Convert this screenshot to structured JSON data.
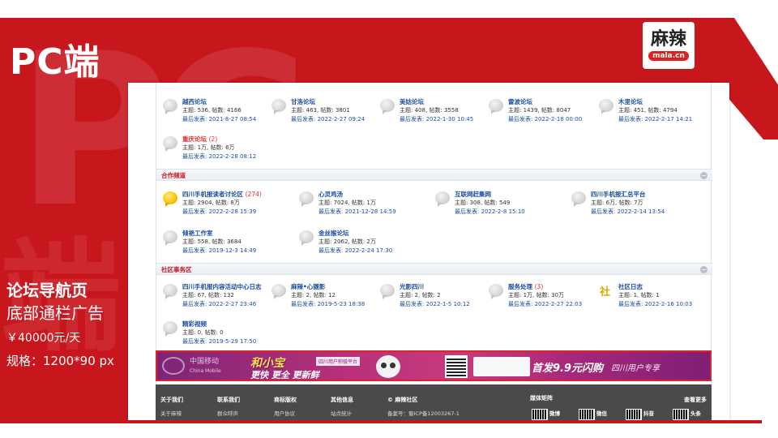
{
  "slide": {
    "title": "PC端",
    "side_lines": [
      "论坛导航页",
      "底部通栏广告",
      "￥40000元/天",
      "规格：1200*90 px"
    ],
    "watermark": "PC",
    "watermark2": "端"
  },
  "logo": {
    "cn": "麻辣",
    "en": "mala.cn"
  },
  "forum": {
    "rows": [
      {
        "items": [
          {
            "name": "越西论坛",
            "stat": "主题: 536, 帖数: 4166",
            "last": "最后发表: 2021-8-27 08:54"
          },
          {
            "name": "甘洛论坛",
            "stat": "主题: 463, 帖数: 3801",
            "last": "最后发表: 2022-2-27 09:24"
          },
          {
            "name": "美姑论坛",
            "stat": "主题: 408, 帖数: 3558",
            "last": "最后发表: 2022-1-30 10:45"
          },
          {
            "name": "雷波论坛",
            "stat": "主题: 1439, 帖数: 8047",
            "last": "最后发表: 2022-2-18 00:00"
          },
          {
            "name": "木里论坛",
            "stat": "主题: 451, 帖数: 4794",
            "last": "最后发表: 2022-2-17 14:21"
          }
        ]
      },
      {
        "items": [
          {
            "name": "重庆论坛",
            "count": "(2)",
            "stat": "主题: 1万, 帖数: 6万",
            "last": "最后发表: 2022-2-28 08:12"
          }
        ]
      }
    ],
    "sections": [
      {
        "title": "合作频道",
        "toggle": "−",
        "rows": [
          {
            "items": [
              {
                "name": "四川手机报读者讨论区",
                "count": "(274)",
                "stat": "主题: 2904, 帖数: 8万",
                "last": "最后发表: 2022-2-28 15:39"
              },
              {
                "name": "心灵鸡汤",
                "stat": "主题: 7024, 帖数: 1万",
                "last": "最后发表: 2021-12-28 14:59"
              },
              {
                "name": "互联网赶集网",
                "stat": "主题: 308, 帖数: 549",
                "last": "最后发表: 2022-2-8 15:10"
              },
              {
                "name": "四川手机报汇总平台",
                "stat": "主题: 6万, 帖数: 7万",
                "last": "最后发表: 2022-2-14 13:54"
              }
            ]
          },
          {
            "items": [
              {
                "name": "倾艳工作室",
                "stat": "主题: 558, 帖数: 3684",
                "last": "最后发表: 2019-12-3 14:49"
              },
              {
                "name": "金丝猴论坛",
                "stat": "主题: 2062, 帖数: 2万",
                "last": "最后发表: 2022-2-24 17:30"
              }
            ]
          }
        ]
      },
      {
        "title": "社区事务区",
        "toggle": "−",
        "rows": [
          {
            "items": [
              {
                "name": "四川手机报内容活动中心日志",
                "stat": "主题: 67, 帖数: 132",
                "last": "最后发表: 2022-2-27 23:46"
              },
              {
                "name": "麻辣•心摄影",
                "stat": "主题: 2, 帖数: 12",
                "last": "最后发表: 2019-5-23 18:38"
              },
              {
                "name": "光影四川",
                "stat": "主题: 2, 帖数: 2",
                "last": "最后发表: 2022-1-5 10:12"
              },
              {
                "name": "服务处理",
                "count": "(3)",
                "stat": "主题: 1万, 帖数: 30万",
                "last": "最后发表: 2022-2-27 22:03"
              },
              {
                "name": "社区日志",
                "stat": "主题: 1, 帖数: 1",
                "last": "最后发表: 2022-2-16 10:03"
              }
            ]
          },
          {
            "items": [
              {
                "name": "精彩视频",
                "stat": "主题: 0, 帖数: 0",
                "last": "最后发表: 2019-5-29 17:50"
              }
            ]
          }
        ]
      }
    ]
  },
  "banner": {
    "brand_cn": "中国移动",
    "brand_en": "China Mobile",
    "main": "和小宝",
    "sub": "更快 更全 更新鲜",
    "tag": "四川用户积极平台",
    "right": "首发9.9元闪购",
    "right2": "四川用户专享"
  },
  "footer": {
    "cols": [
      {
        "title": "关于我们",
        "sub": "关于麻辣"
      },
      {
        "title": "联系我们",
        "sub": "群众呼声"
      },
      {
        "title": "商标版权",
        "sub": "用户协议"
      },
      {
        "title": "其他信息",
        "sub": "站点统计"
      },
      {
        "title": "© 麻辣社区",
        "sub": "备案号：蜀ICP备12003267-1"
      }
    ],
    "media_title": "媒体矩阵",
    "more": "查看更多",
    "qr_labels": [
      "微博",
      "微信",
      "抖音",
      "头条"
    ]
  },
  "colors": {
    "brand_red": "#c8161d",
    "link_blue": "#1b4fa3",
    "banner_purple": "#b8317a"
  }
}
